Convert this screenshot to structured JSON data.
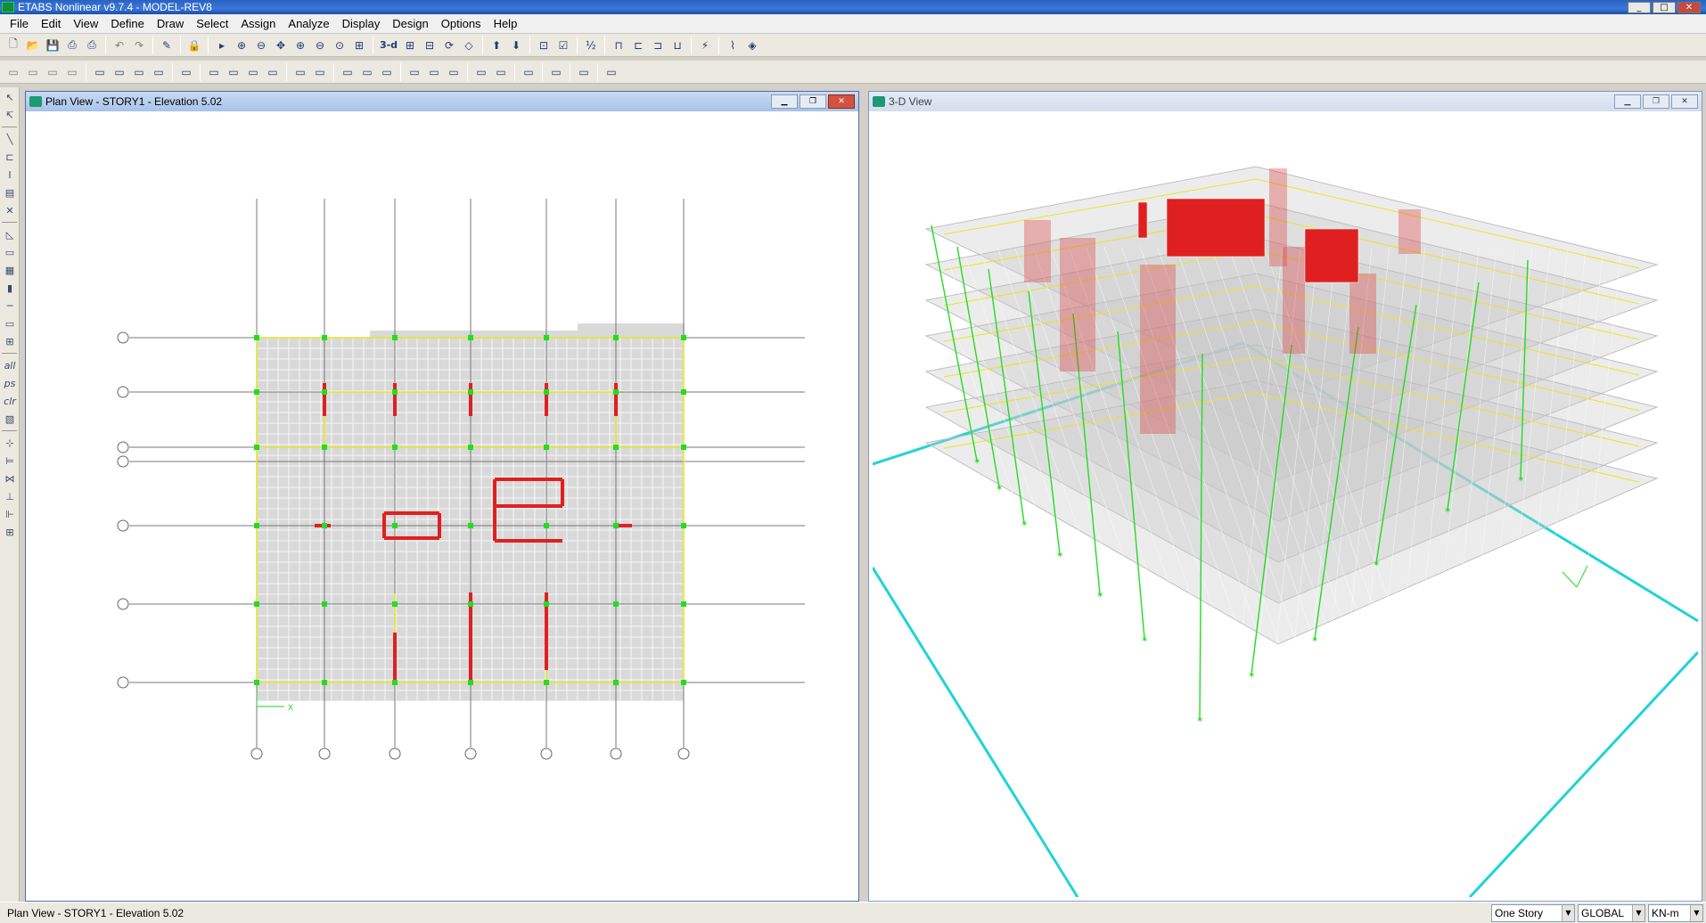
{
  "app": {
    "title": "ETABS Nonlinear v9.7.4 - MODEL-REV8",
    "window_buttons": [
      "_",
      "□",
      "✕"
    ]
  },
  "menu": [
    "File",
    "Edit",
    "View",
    "Define",
    "Draw",
    "Select",
    "Assign",
    "Analyze",
    "Display",
    "Design",
    "Options",
    "Help"
  ],
  "toolbar1": [
    "new-icon",
    "open-icon",
    "save-icon",
    "print-icon",
    "print-graphics-icon",
    "sep",
    "undo-icon",
    "redo-icon",
    "sep",
    "refresh-icon",
    "sep",
    "lock-icon",
    "sep",
    "pointer-icon",
    "rubber-band-zoom-icon",
    "restore-view-icon",
    "pan-icon",
    "zoom-in-icon",
    "zoom-out-icon",
    "zoom-previous-icon",
    "zoom-all-icon",
    "sep",
    "3d-view-icon",
    "plan-view-icon",
    "elevation-view-icon",
    "rotate-3d-icon",
    "perspective-icon",
    "sep",
    "move-up-icon",
    "move-down-icon",
    "sep",
    "object-shrink-icon",
    "set-display-icon",
    "sep",
    "snap-icon",
    "sep",
    "frame-icon",
    "wall-icon",
    "opening-icon",
    "link-icon",
    "sep",
    "run-analysis-icon",
    "sep",
    "deformed-shape-icon",
    "animation-icon"
  ],
  "toolbar1_text": {
    "three_d": "3-d"
  },
  "toolbar2": [
    "select-all-icon",
    "select-cross-icon",
    "select-poly-icon",
    "select-options-icon",
    "sep",
    "story-up-icon",
    "story-down-icon",
    "story-similar-icon",
    "story-all-icon",
    "sep",
    "grid-icon",
    "sep",
    "joint-restraint-icon",
    "joint-spring-icon",
    "diaphragm-icon",
    "mass-icon",
    "sep",
    "frame-section-icon",
    "frame-release-icon",
    "sep",
    "frame-loads-icon",
    "area-loads-icon",
    "pier-label-icon",
    "sep",
    "show-forces-icon",
    "show-stress-icon",
    "show-deformed-icon",
    "sep",
    "display-table-icon",
    "query-icon",
    "sep",
    "beam-design-icon",
    "sep",
    "concrete-design-icon",
    "sep",
    "steel-design-icon",
    "sep",
    "composite-design-icon"
  ],
  "left_tools": [
    "pointer-icon",
    "reshape-icon",
    "sep",
    "draw-line-icon",
    "draw-beam-icon",
    "draw-column-icon",
    "draw-brace-icon",
    "draw-link-icon",
    "sep",
    "draw-area-icon",
    "draw-rect-area-icon",
    "draw-region-icon",
    "draw-wall-icon",
    "draw-openings-icon",
    "draw-walls-icon",
    "draw-point-icon",
    "sep",
    "select-all-icon",
    "select-prev-icon",
    "clear-selection-icon",
    "select-intersect-icon",
    "sep",
    "snap-end-icon",
    "snap-mid-icon",
    "snap-intersect-icon",
    "snap-perp-icon",
    "snap-lines-icon",
    "snap-fine-grid-icon"
  ],
  "left_tools_text": {
    "all": "all",
    "ps": "ps",
    "clr": "clr"
  },
  "plan_window": {
    "title": "Plan View - STORY1 - Elevation 5.02",
    "axis_x_label": "X"
  },
  "view3d_window": {
    "title": "3-D View"
  },
  "status": {
    "text": "Plan View - STORY1 - Elevation 5.02",
    "story_select": "One Story",
    "coord_select": "GLOBAL",
    "units_select": "KN-m"
  },
  "colors": {
    "title_active": "#a8c3ea",
    "slab": "#d9d9d9",
    "wall": "#e02020",
    "beam": "#e6e626",
    "joint": "#22dd22",
    "grid": "#1fd4d4"
  }
}
